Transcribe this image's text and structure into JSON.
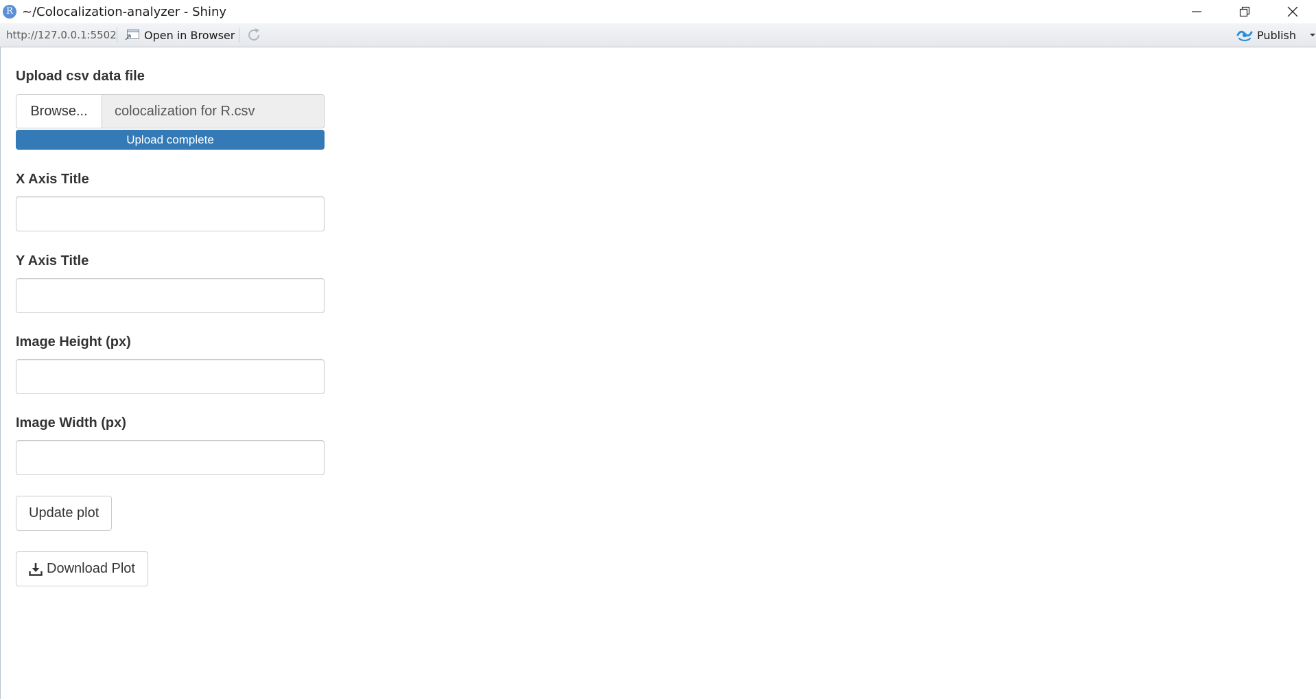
{
  "window": {
    "icon_letter": "R",
    "title": "~/Colocalization-analyzer - Shiny"
  },
  "toolbar": {
    "url": "http://127.0.0.1:5502",
    "open_in_browser": "Open in Browser",
    "publish": "Publish"
  },
  "form": {
    "upload_label": "Upload csv data file",
    "browse_label": "Browse...",
    "file_name": "colocalization for R.csv",
    "upload_status": "Upload complete",
    "upload_progress": 1.0,
    "x_axis_label": "X Axis Title",
    "x_axis_value": "",
    "y_axis_label": "Y Axis Title",
    "y_axis_value": "",
    "height_label": "Image Height (px)",
    "height_value": "",
    "width_label": "Image Width (px)",
    "width_value": "",
    "update_button": "Update plot",
    "download_button": "Download Plot"
  },
  "colors": {
    "progress": "#337ab7",
    "publish_icon": "#2e8fd6"
  }
}
